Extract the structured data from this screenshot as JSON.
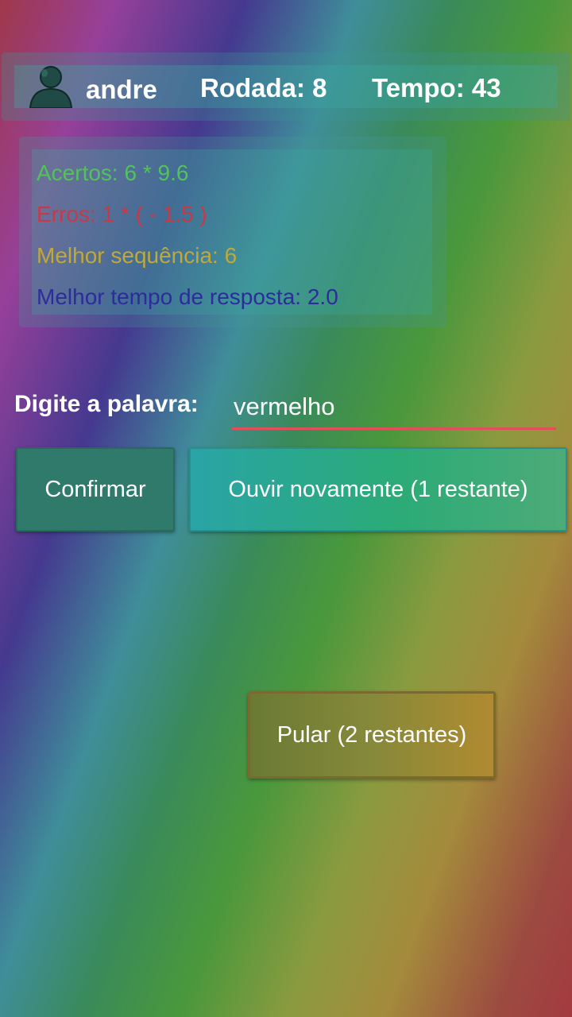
{
  "header": {
    "username": "andre",
    "round": "Rodada: 8",
    "time": "Tempo:  43"
  },
  "stats": {
    "correct": "Acertos: 6 * 9.6",
    "errors": "Erros: 1 * ( - 1.5 )",
    "best_streak": "Melhor sequência: 6",
    "best_response_time": "Melhor tempo de resposta: 2.0"
  },
  "input": {
    "label": "Digite a palavra:",
    "value": "vermelho"
  },
  "buttons": {
    "confirm": "Confirmar",
    "replay": "Ouvir novamente (1 restante)",
    "skip": "Pular (2 restantes)"
  },
  "colors": {
    "correct": "#52c35a",
    "errors": "#c63a48",
    "best_streak": "#c0a83a",
    "best_response_time": "#2c2c9a",
    "input_underline": "#e0505a"
  },
  "icons": {
    "avatar": "user-icon"
  }
}
